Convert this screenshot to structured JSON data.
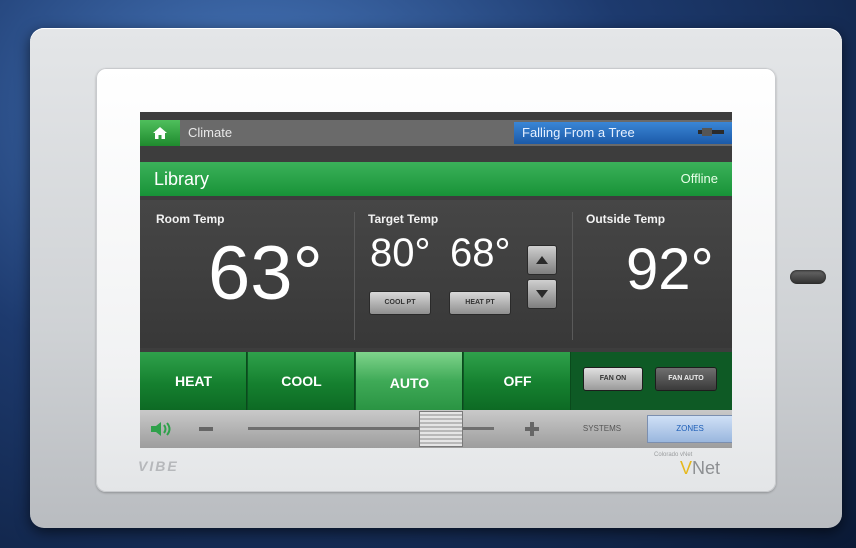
{
  "header": {
    "breadcrumb": "Climate",
    "now_playing": "Falling From a Tree"
  },
  "zone": {
    "name": "Library",
    "status": "Offline"
  },
  "room": {
    "label": "Room Temp",
    "value": "63°"
  },
  "target": {
    "label": "Target Temp",
    "cool_value": "80°",
    "heat_value": "68°",
    "cool_button": "COOL PT",
    "heat_button": "HEAT PT"
  },
  "outside": {
    "label": "Outside Temp",
    "value": "92°"
  },
  "modes": [
    {
      "label": "HEAT",
      "active": false
    },
    {
      "label": "COOL",
      "active": false
    },
    {
      "label": "AUTO",
      "active": true
    },
    {
      "label": "OFF",
      "active": false
    }
  ],
  "fan": {
    "on_label": "FAN ON",
    "auto_label": "FAN AUTO"
  },
  "bottom": {
    "systems_label": "SYSTEMS",
    "zones_label": "ZONES"
  },
  "brand": {
    "device": "VIBE",
    "company_small": "Colorado vNet",
    "company": "Net"
  },
  "colors": {
    "accent_green": "#189338",
    "now_playing_blue": "#1c5aa8"
  }
}
